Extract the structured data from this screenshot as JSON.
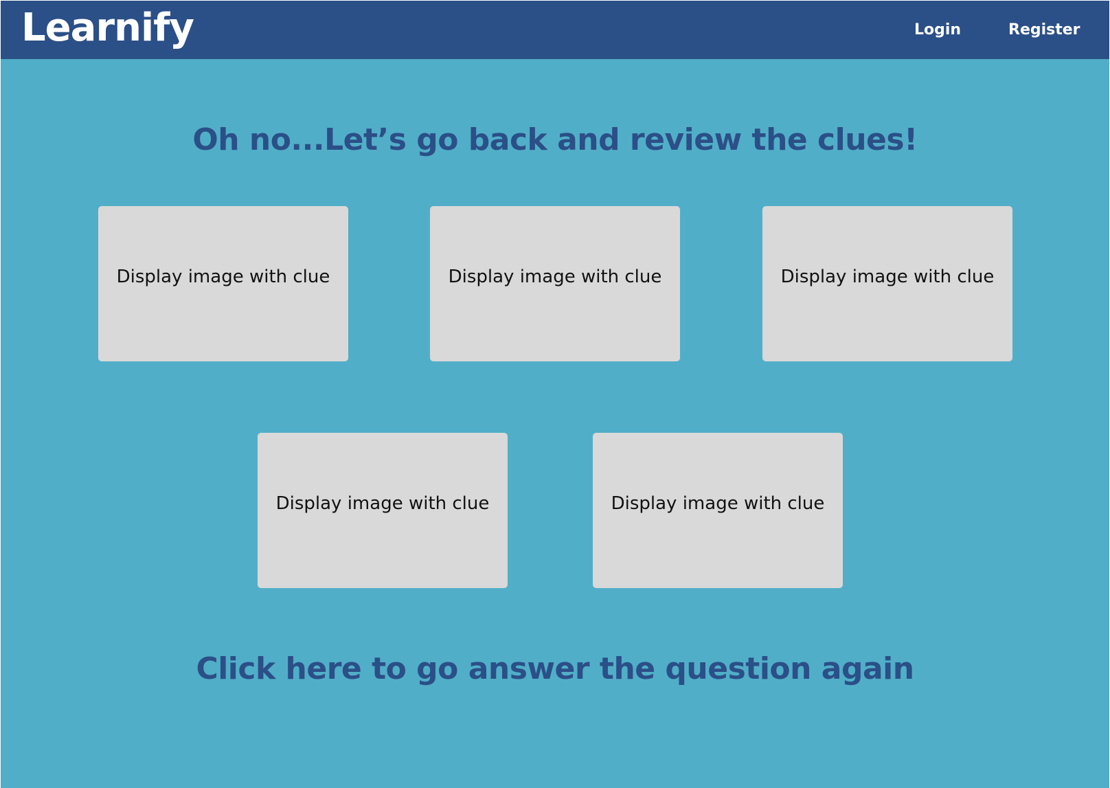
{
  "app": {
    "logo": "Learnify"
  },
  "nav": {
    "login": "Login",
    "register": "Register"
  },
  "main": {
    "heading": "Oh no...Let’s go back and review the clues!",
    "clues": [
      {
        "label": "Display image with clue"
      },
      {
        "label": "Display image with clue"
      },
      {
        "label": "Display image with clue"
      },
      {
        "label": "Display image with clue"
      },
      {
        "label": "Display image with clue"
      }
    ],
    "retry_link": "Click here to go answer the question again"
  },
  "colors": {
    "navbar": "#2B4F87",
    "background": "#51AEC8",
    "card": "#D9D9D9",
    "heading": "#2B4F87"
  }
}
